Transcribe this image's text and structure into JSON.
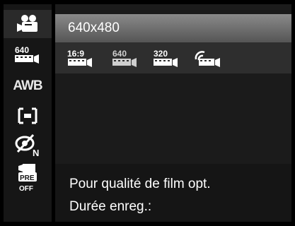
{
  "sidebar": {
    "items": [
      {
        "icon": "movie-camera-icon"
      },
      {
        "icon": "resolution-640-icon",
        "label": "640"
      },
      {
        "icon": "awb-icon",
        "label": "AWB"
      },
      {
        "icon": "focus-frame-icon"
      },
      {
        "icon": "face-detect-icon",
        "label": "N"
      },
      {
        "icon": "pre-record-icon",
        "label": "PRE",
        "sublabel": "OFF"
      }
    ]
  },
  "main": {
    "selected_option_label": "640x480",
    "options": [
      {
        "icon": "film-16-9-icon",
        "label": "16:9"
      },
      {
        "icon": "film-640-icon",
        "label": "640"
      },
      {
        "icon": "film-320-icon",
        "label": "320"
      },
      {
        "icon": "film-web-icon"
      }
    ],
    "info": {
      "line1": "Pour qualité de film opt.",
      "line2": "Durée enreg.:"
    }
  },
  "colors": {
    "background": "#000000",
    "panel": "#1b1b1b",
    "highlight": "#7a7a7a",
    "text": "#ffffff"
  }
}
